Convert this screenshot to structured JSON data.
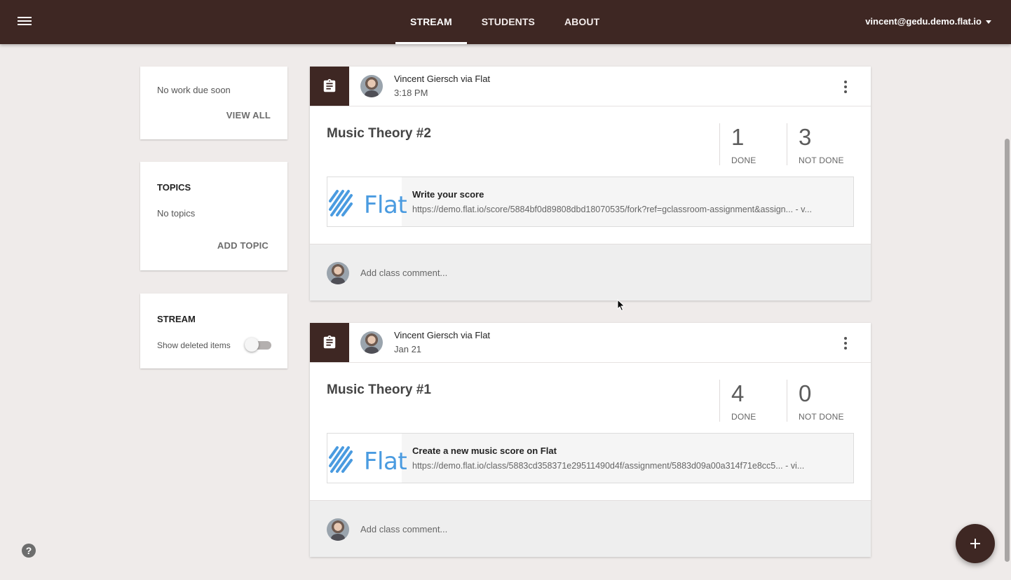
{
  "header": {
    "tabs": [
      {
        "label": "STREAM",
        "active": true
      },
      {
        "label": "STUDENTS",
        "active": false
      },
      {
        "label": "ABOUT",
        "active": false
      }
    ],
    "account": "vincent@gedu.demo.flat.io",
    "brand_color": "#3e2723"
  },
  "sidebar": {
    "upcoming": {
      "text": "No work due soon",
      "link": "VIEW ALL"
    },
    "topics": {
      "title": "TOPICS",
      "text": "No topics",
      "link": "ADD TOPIC"
    },
    "stream": {
      "title": "STREAM",
      "toggle_label": "Show deleted items",
      "toggle_on": false
    }
  },
  "posts": [
    {
      "author": "Vincent Giersch via Flat",
      "time": "3:18 PM",
      "title": "Music Theory #2",
      "done": "1",
      "done_label": "DONE",
      "not_done": "3",
      "not_done_label": "NOT DONE",
      "attachment": {
        "logo": "Flat",
        "title": "Write your score",
        "url": "https://demo.flat.io/score/5884bf0d89808dbd18070535/fork?ref=gclassroom-assignment&assign...",
        "url_suffix": " - v..."
      },
      "comment_placeholder": "Add class comment..."
    },
    {
      "author": "Vincent Giersch via Flat",
      "time": "Jan 21",
      "title": "Music Theory #1",
      "done": "4",
      "done_label": "DONE",
      "not_done": "0",
      "not_done_label": "NOT DONE",
      "attachment": {
        "logo": "Flat",
        "title": "Create a new music score on Flat",
        "url": "https://demo.flat.io/class/5883cd358371e29511490d4f/assignment/5883d09a00a314f71e8cc5...",
        "url_suffix": " - vi..."
      },
      "comment_placeholder": "Add class comment..."
    }
  ],
  "help_label": "?"
}
